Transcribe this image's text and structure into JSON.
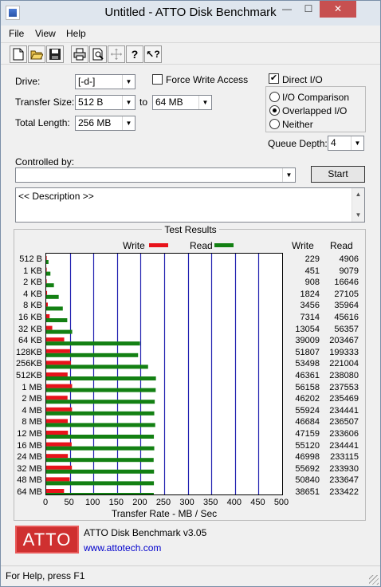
{
  "window": {
    "title": "Untitled - ATTO Disk Benchmark",
    "minimize_glyph": "—",
    "maximize_glyph": "☐",
    "close_glyph": "✕"
  },
  "menu": [
    "File",
    "View",
    "Help"
  ],
  "toolbar_icons": [
    "new-file-icon",
    "open-folder-icon",
    "save-icon",
    "print-icon",
    "print-preview-icon",
    "move-icon",
    "help-icon",
    "context-help-icon"
  ],
  "settings": {
    "drive_label": "Drive:",
    "drive_value": "[-d-]",
    "transfer_size_label": "Transfer Size:",
    "transfer_from": "512 B",
    "to_label": "to",
    "transfer_to": "64 MB",
    "total_length_label": "Total Length:",
    "total_length_value": "256 MB",
    "force_write_access_label": "Force Write Access",
    "force_write_access_checked": false,
    "direct_io_label": "Direct I/O",
    "direct_io_checked": true,
    "io_comparison_label": "I/O Comparison",
    "overlapped_io_label": "Overlapped I/O",
    "neither_label": "Neither",
    "selected_io_mode": "Overlapped I/O",
    "queue_depth_label": "Queue Depth:",
    "queue_depth_value": "4",
    "controlled_by_label": "Controlled by:",
    "controlled_by_value": "",
    "start_button": "Start",
    "description": "<< Description >>"
  },
  "results": {
    "title": "Test Results",
    "legend_write": "Write",
    "legend_read": "Read",
    "col_write": "Write",
    "col_read": "Read",
    "write_color": "#e8131b",
    "read_color": "#138013"
  },
  "chart_data": {
    "type": "bar",
    "orientation": "horizontal",
    "title": "Test Results",
    "xlabel": "Transfer Rate - MB / Sec",
    "xlim": [
      0,
      500
    ],
    "xticks": [
      "0",
      "50",
      "100",
      "150",
      "200",
      "250",
      "300",
      "350",
      "400",
      "450",
      "500"
    ],
    "grid": true,
    "legend_position": "top",
    "categories": [
      "512 B",
      "1 KB",
      "2 KB",
      "4 KB",
      "8 KB",
      "16 KB",
      "32 KB",
      "64 KB",
      "128KB",
      "256KB",
      "512KB",
      "1 MB",
      "2 MB",
      "4 MB",
      "8 MB",
      "12 MB",
      "16 MB",
      "24 MB",
      "32 MB",
      "48 MB",
      "64 MB"
    ],
    "series": [
      {
        "name": "Write",
        "unit": "KB/s",
        "values": [
          229,
          451,
          908,
          1824,
          3456,
          7314,
          13054,
          39009,
          51807,
          53498,
          46361,
          56158,
          46202,
          55924,
          46684,
          47159,
          55120,
          46998,
          55692,
          50840,
          38651
        ]
      },
      {
        "name": "Read",
        "unit": "KB/s",
        "values": [
          4906,
          9079,
          16646,
          27105,
          35964,
          45616,
          56357,
          203467,
          199333,
          221004,
          238080,
          237553,
          235469,
          234441,
          236507,
          233606,
          234441,
          233115,
          233930,
          233647,
          233422
        ]
      }
    ]
  },
  "footer": {
    "logo_text": "ATTO",
    "version": "ATTO Disk Benchmark v3.05",
    "url": "www.attotech.com"
  },
  "status": {
    "text": "For Help, press F1"
  }
}
